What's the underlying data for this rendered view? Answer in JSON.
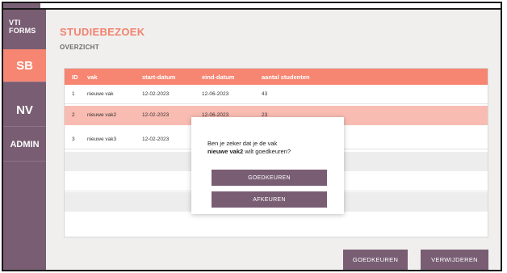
{
  "sidebar": {
    "brand_line1": "VTI",
    "brand_line2": "FORMS",
    "items": [
      {
        "label": "SB",
        "active": true
      },
      {
        "label": "NV",
        "active": false
      },
      {
        "label": "ADMIN",
        "active": false
      }
    ]
  },
  "page": {
    "title": "STUDIEBEZOEK",
    "subtitle": "OVERZICHT"
  },
  "table": {
    "columns": [
      "ID",
      "vak",
      "start-datum",
      "eind-datum",
      "aantal studenten"
    ],
    "rows": [
      {
        "id": "1",
        "vak": "nieuwe vak",
        "start": "12-02-2023",
        "eind": "12-06-2023",
        "aantal": "43"
      },
      {
        "id": "2",
        "vak": "nieuwe vak2",
        "start": "12-02-2023",
        "eind": "12-06-2023",
        "aantal": "23"
      },
      {
        "id": "3",
        "vak": "nieuwe vak3",
        "start": "12-02-2023",
        "eind": "",
        "aantal": ""
      }
    ],
    "selected_row": 2
  },
  "actions": {
    "approve_label": "GOEDKEUREN",
    "delete_label": "VERWIJDEREN"
  },
  "modal": {
    "text_before": "Ben je zeker dat je de vak",
    "vak_name": "nieuwe vak2",
    "text_after": "wilt goedkeuren?",
    "approve_label": "GOEDKEUREN",
    "reject_label": "AFKEUREN"
  },
  "colors": {
    "accent": "#f68672",
    "sidebar": "#785d73",
    "selected_row": "#f9bcb2"
  }
}
